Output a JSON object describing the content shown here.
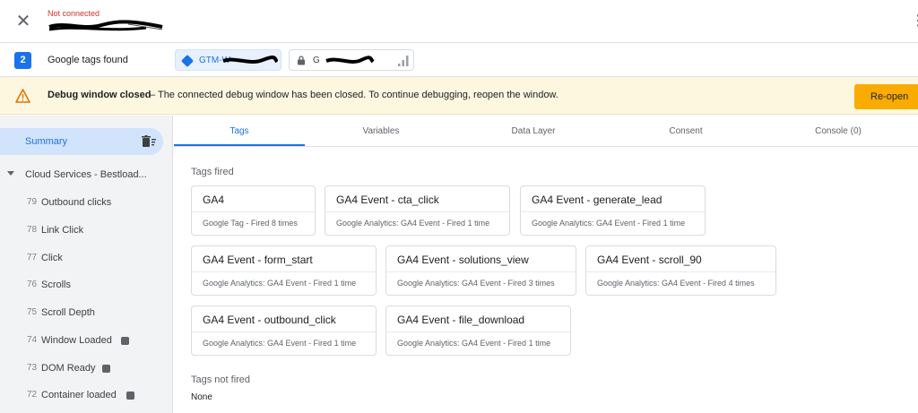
{
  "header": {
    "status": "Not connected"
  },
  "tagsbar": {
    "count": "2",
    "found_label": "Google tags found",
    "gtm_chip": "GTM-W",
    "g_chip": "G-8"
  },
  "banner": {
    "title": "Debug window closed",
    "text": "–  The connected debug window has been closed. To continue debugging, reopen the window.",
    "button": "Re-open"
  },
  "sidebar": {
    "summary": "Summary",
    "container": "Cloud Services - Bestload...",
    "events": [
      {
        "num": "79",
        "label": "Outbound clicks",
        "badge": false
      },
      {
        "num": "78",
        "label": "Link Click",
        "badge": false
      },
      {
        "num": "77",
        "label": "Click",
        "badge": false
      },
      {
        "num": "76",
        "label": "Scrolls",
        "badge": false
      },
      {
        "num": "75",
        "label": "Scroll Depth",
        "badge": false
      },
      {
        "num": "74",
        "label": "Window Loaded",
        "badge": true
      },
      {
        "num": "73",
        "label": "DOM Ready",
        "badge": true
      },
      {
        "num": "72",
        "label": "Container loaded",
        "badge": true
      }
    ]
  },
  "tabs": [
    {
      "label": "Tags",
      "active": true
    },
    {
      "label": "Variables",
      "active": false
    },
    {
      "label": "Data Layer",
      "active": false
    },
    {
      "label": "Consent",
      "active": false
    },
    {
      "label": "Console (0)",
      "active": false
    }
  ],
  "content": {
    "fired_title": "Tags fired",
    "fired": [
      {
        "name": "GA4",
        "desc": "Google Tag - Fired 8 times"
      },
      {
        "name": "GA4 Event - cta_click",
        "desc": "Google Analytics: GA4 Event - Fired 1 time"
      },
      {
        "name": "GA4 Event - generate_lead",
        "desc": "Google Analytics: GA4 Event - Fired 1 time"
      },
      {
        "name": "GA4 Event - form_start",
        "desc": "Google Analytics: GA4 Event - Fired 1 time"
      },
      {
        "name": "GA4 Event - solutions_view",
        "desc": "Google Analytics: GA4 Event - Fired 3 times"
      },
      {
        "name": "GA4 Event - scroll_90",
        "desc": "Google Analytics: GA4 Event - Fired 4 times"
      },
      {
        "name": "GA4 Event - outbound_click",
        "desc": "Google Analytics: GA4 Event - Fired 1 time"
      },
      {
        "name": "GA4 Event - file_download",
        "desc": "Google Analytics: GA4 Event - Fired 1 time"
      }
    ],
    "not_fired_title": "Tags not fired",
    "not_fired_none": "None"
  },
  "colors": {
    "accent": "#1a73e8",
    "warning_bg": "#fef7e0",
    "reopen_button": "#f9ab00",
    "not_connected": "#d93025"
  }
}
